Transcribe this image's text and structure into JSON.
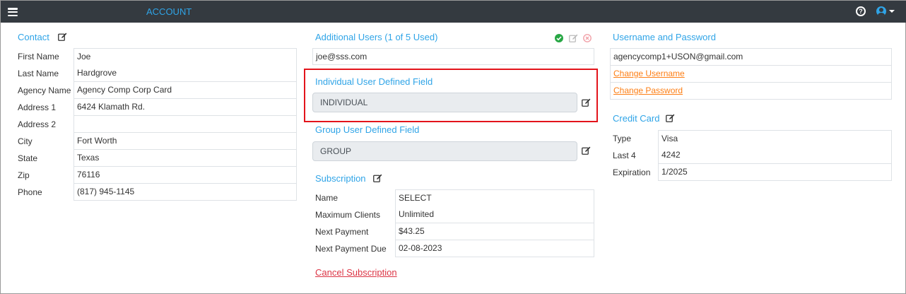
{
  "header": {
    "title": "ACCOUNT"
  },
  "contact": {
    "title": "Contact",
    "rows": [
      {
        "label": "First Name",
        "value": "Joe"
      },
      {
        "label": "Last Name",
        "value": "Hardgrove"
      },
      {
        "label": "Agency Name",
        "value": "Agency Comp Corp Card"
      },
      {
        "label": "Address 1",
        "value": "6424 Klamath Rd."
      },
      {
        "label": "Address 2",
        "value": ""
      },
      {
        "label": "City",
        "value": "Fort Worth"
      },
      {
        "label": "State",
        "value": "Texas"
      },
      {
        "label": "Zip",
        "value": "76116"
      },
      {
        "label": "Phone",
        "value": "(817) 945-1145"
      }
    ]
  },
  "additional_users": {
    "title": "Additional Users (1 of 5 Used)",
    "users": [
      "joe@sss.com"
    ]
  },
  "individual_field": {
    "title": "Individual User Defined Field",
    "value": "INDIVIDUAL"
  },
  "group_field": {
    "title": "Group User Defined Field",
    "value": "GROUP"
  },
  "subscription": {
    "title": "Subscription",
    "rows": [
      {
        "label": "Name",
        "value": "SELECT"
      },
      {
        "label": "Maximum Clients",
        "value": "Unlimited"
      },
      {
        "label": "Next Payment",
        "value": "$43.25"
      },
      {
        "label": "Next Payment Due",
        "value": "02-08-2023"
      }
    ],
    "cancel_label": "Cancel Subscription"
  },
  "credentials": {
    "title": "Username and Password",
    "username": "agencycomp1+USON@gmail.com",
    "change_username": "Change Username",
    "change_password": "Change Password"
  },
  "credit_card": {
    "title": "Credit Card",
    "rows": [
      {
        "label": "Type",
        "value": "Visa"
      },
      {
        "label": "Last 4",
        "value": "4242"
      },
      {
        "label": "Expiration",
        "value": "1/2025"
      }
    ]
  },
  "icons": {
    "menu": "hamburger-icon",
    "help": "help-icon",
    "user": "user-circle-icon",
    "edit": "edit-icon",
    "confirm": "check-circle-icon",
    "cancel": "close-circle-icon"
  },
  "colors": {
    "topbar": "#343a40",
    "accent": "#2fa4e7",
    "link_orange": "#fd7e14",
    "link_red": "#dc3545",
    "highlight": "#e3141b",
    "success": "#28a745"
  }
}
